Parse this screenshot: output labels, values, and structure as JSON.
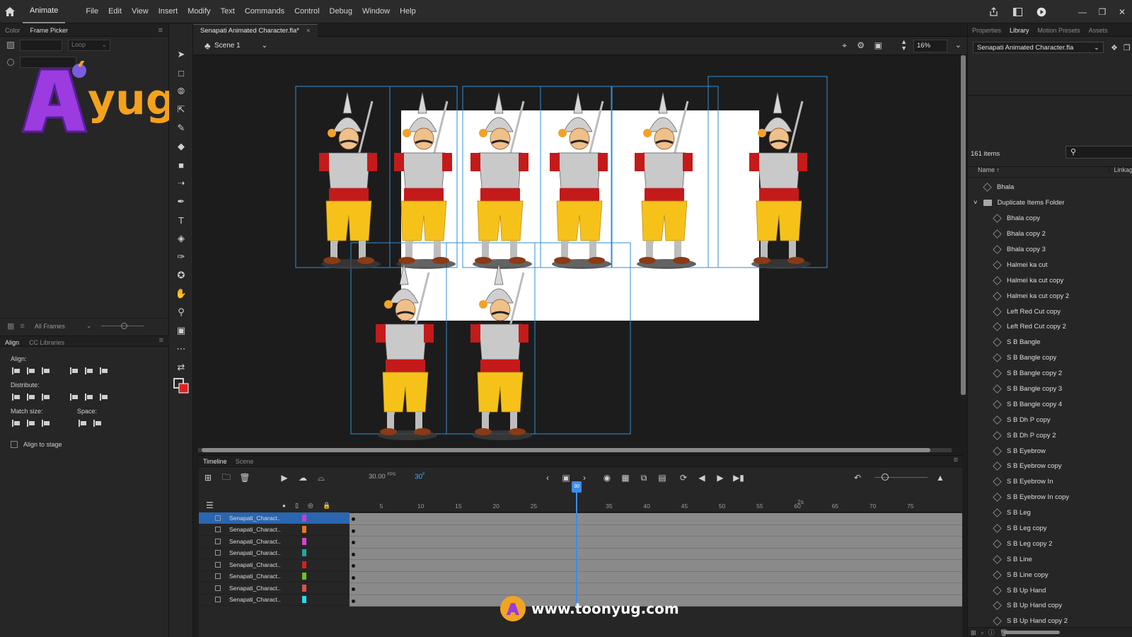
{
  "menubar": {
    "app_tab": "Animate",
    "items": [
      "File",
      "Edit",
      "View",
      "Insert",
      "Modify",
      "Text",
      "Commands",
      "Control",
      "Debug",
      "Window",
      "Help"
    ]
  },
  "left_panel": {
    "tabs": [
      "Color",
      "Frame Picker"
    ],
    "frame_picker": {
      "loop_label": "Loop",
      "all_frames_label": "All Frames"
    },
    "logo_text": "yug",
    "align_tabs": [
      "Align",
      "CC Libraries"
    ],
    "align": {
      "align_label": "Align:",
      "distribute_label": "Distribute:",
      "match_size_label": "Match size:",
      "space_label": "Space:",
      "align_to_stage_label": "Align to stage"
    }
  },
  "document": {
    "tab_title": "Senapati Animated Character.fla*",
    "scene_name": "Scene 1",
    "zoom": "16%"
  },
  "timeline": {
    "tabs": [
      "Timeline",
      "Scene"
    ],
    "fps_value": "30.00",
    "fps_unit": "FPS",
    "current_frame": "30",
    "current_frame_suffix": "F",
    "ruler_labels": [
      "5",
      "10",
      "15",
      "20",
      "25",
      "35",
      "40",
      "45",
      "50",
      "55",
      "60",
      "65",
      "70",
      "75"
    ],
    "playhead_label": "30",
    "seconds_marker": "2s",
    "layers": [
      {
        "name": "Senapati_Charact..",
        "color": "#c23fd0"
      },
      {
        "name": "Senapati_Charact..",
        "color": "#e07a1f"
      },
      {
        "name": "Senapati_Charact..",
        "color": "#d447c9"
      },
      {
        "name": "Senapati_Charact..",
        "color": "#22a6a0"
      },
      {
        "name": "Senapati_Charact..",
        "color": "#d42020"
      },
      {
        "name": "Senapati_Charact..",
        "color": "#6fbf2a"
      },
      {
        "name": "Senapati_Charact..",
        "color": "#e05050"
      },
      {
        "name": "Senapati_Charact..",
        "color": "#2ed8e8"
      }
    ]
  },
  "watermark": {
    "url": "www.toonyug.com"
  },
  "right_panel": {
    "tabs": [
      "Properties",
      "Library",
      "Motion Presets",
      "Assets"
    ],
    "library_select": "Senapati Animated Character.fla",
    "item_count": "161 items",
    "col_name": "Name",
    "col_linkage": "Linkag",
    "items": [
      {
        "label": "Bhala",
        "type": "symbol",
        "indent": 0
      },
      {
        "label": "Duplicate Items Folder",
        "type": "folder",
        "indent": 0
      },
      {
        "label": "Bhala copy",
        "type": "symbol",
        "indent": 1
      },
      {
        "label": "Bhala copy 2",
        "type": "symbol",
        "indent": 1
      },
      {
        "label": "Bhala copy 3",
        "type": "symbol",
        "indent": 1
      },
      {
        "label": "Halmei ka cut",
        "type": "symbol",
        "indent": 1
      },
      {
        "label": "Halmei ka cut copy",
        "type": "symbol",
        "indent": 1
      },
      {
        "label": "Halmei ka cut copy 2",
        "type": "symbol",
        "indent": 1
      },
      {
        "label": "Left Red Cut copy",
        "type": "symbol",
        "indent": 1
      },
      {
        "label": "Left Red Cut copy 2",
        "type": "symbol",
        "indent": 1
      },
      {
        "label": "S B Bangle",
        "type": "symbol",
        "indent": 1
      },
      {
        "label": "S B Bangle copy",
        "type": "symbol",
        "indent": 1
      },
      {
        "label": "S B Bangle copy 2",
        "type": "symbol",
        "indent": 1
      },
      {
        "label": "S B Bangle copy 3",
        "type": "symbol",
        "indent": 1
      },
      {
        "label": "S B Bangle copy 4",
        "type": "symbol",
        "indent": 1
      },
      {
        "label": "S B Dh P copy",
        "type": "symbol",
        "indent": 1
      },
      {
        "label": "S B Dh P copy 2",
        "type": "symbol",
        "indent": 1
      },
      {
        "label": "S B Eyebrow",
        "type": "symbol",
        "indent": 1
      },
      {
        "label": "S B Eyebrow copy",
        "type": "symbol",
        "indent": 1
      },
      {
        "label": "S B Eyebrow In",
        "type": "symbol",
        "indent": 1
      },
      {
        "label": "S B Eyebrow In copy",
        "type": "symbol",
        "indent": 1
      },
      {
        "label": "S B Leg",
        "type": "symbol",
        "indent": 1
      },
      {
        "label": "S B Leg copy",
        "type": "symbol",
        "indent": 1
      },
      {
        "label": "S B Leg copy 2",
        "type": "symbol",
        "indent": 1
      },
      {
        "label": "S B Line",
        "type": "symbol",
        "indent": 1
      },
      {
        "label": "S B Line copy",
        "type": "symbol",
        "indent": 1
      },
      {
        "label": "S B Up Hand",
        "type": "symbol",
        "indent": 1
      },
      {
        "label": "S B Up Hand copy",
        "type": "symbol",
        "indent": 1
      },
      {
        "label": "S B Up Hand copy 2",
        "type": "symbol",
        "indent": 1
      }
    ]
  },
  "colors": {
    "accent_blue": "#3b8eea",
    "selection_blue": "#2a66b0",
    "frame_outline": "#2f8fd6",
    "logo_purple": "#9b3be0",
    "logo_orange": "#f4a21c"
  }
}
